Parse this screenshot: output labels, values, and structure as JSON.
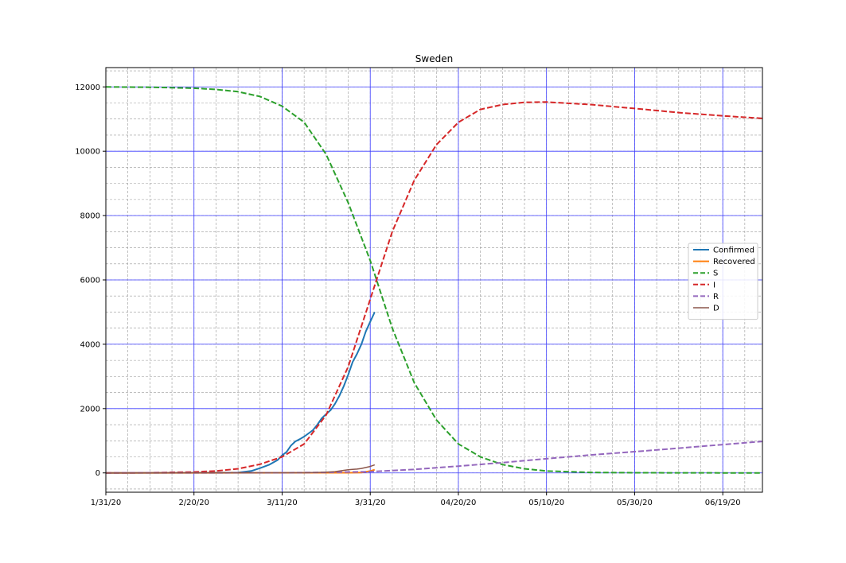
{
  "chart_data": {
    "type": "line",
    "title": "Sweden",
    "xlabel": "",
    "ylabel": "",
    "x_unit": "days since 1/31/20",
    "xlim": [
      0,
      149
    ],
    "ylim": [
      -600,
      12600
    ],
    "x_ticks": [
      {
        "x": 0,
        "label": "1/31/20"
      },
      {
        "x": 20,
        "label": "2/20/20"
      },
      {
        "x": 40,
        "label": "3/11/20"
      },
      {
        "x": 60,
        "label": "3/31/20"
      },
      {
        "x": 80,
        "label": "04/20/20"
      },
      {
        "x": 100,
        "label": "05/10/20"
      },
      {
        "x": 120,
        "label": "05/30/20"
      },
      {
        "x": 140,
        "label": "06/19/20"
      }
    ],
    "y_ticks": [
      0,
      2000,
      4000,
      6000,
      8000,
      10000,
      12000
    ],
    "grid": {
      "major": true,
      "minor": true
    },
    "legend_position": "center-right",
    "series": [
      {
        "name": "Confirmed",
        "color": "#1f77b4",
        "style": "solid",
        "width": 2,
        "x": [
          0,
          30,
          33,
          35,
          37,
          39,
          40,
          41,
          42,
          43,
          44,
          45,
          46,
          47,
          48,
          49,
          50,
          51,
          52,
          53,
          54,
          55,
          56,
          57,
          58,
          59,
          60,
          61
        ],
        "y": [
          0,
          10,
          60,
          150,
          250,
          400,
          550,
          650,
          850,
          980,
          1050,
          1130,
          1230,
          1330,
          1500,
          1700,
          1830,
          1950,
          2150,
          2400,
          2700,
          3050,
          3450,
          3700,
          4000,
          4400,
          4700,
          5000
        ]
      },
      {
        "name": "Recovered",
        "color": "#ff7f0e",
        "style": "solid",
        "width": 2,
        "x": [
          0,
          55,
          58,
          60,
          61
        ],
        "y": [
          0,
          5,
          10,
          60,
          100
        ]
      },
      {
        "name": "S",
        "color": "#2ca02c",
        "style": "dashed",
        "width": 2,
        "x": [
          0,
          10,
          20,
          25,
          30,
          35,
          40,
          45,
          50,
          55,
          60,
          65,
          70,
          75,
          80,
          85,
          90,
          95,
          100,
          110,
          120,
          130,
          140,
          149
        ],
        "y": [
          12000,
          11990,
          11960,
          11920,
          11850,
          11700,
          11400,
          10900,
          9900,
          8400,
          6600,
          4500,
          2800,
          1650,
          900,
          500,
          260,
          130,
          60,
          15,
          5,
          2,
          1,
          0
        ]
      },
      {
        "name": "I",
        "color": "#d62728",
        "style": "dashed",
        "width": 2,
        "x": [
          0,
          10,
          20,
          25,
          30,
          35,
          40,
          45,
          50,
          55,
          60,
          65,
          70,
          75,
          80,
          85,
          90,
          95,
          100,
          110,
          120,
          130,
          140,
          149
        ],
        "y": [
          0,
          5,
          30,
          60,
          130,
          270,
          500,
          900,
          1800,
          3300,
          5400,
          7500,
          9100,
          10200,
          10900,
          11300,
          11450,
          11520,
          11530,
          11450,
          11330,
          11200,
          11100,
          11020
        ]
      },
      {
        "name": "R",
        "color": "#9467bd",
        "style": "dashed",
        "width": 2,
        "x": [
          0,
          40,
          50,
          60,
          70,
          80,
          90,
          100,
          110,
          120,
          130,
          140,
          149
        ],
        "y": [
          0,
          5,
          15,
          40,
          110,
          210,
          320,
          440,
          560,
          660,
          770,
          880,
          980
        ]
      },
      {
        "name": "D",
        "color": "#8c564b",
        "style": "solid",
        "width": 1.5,
        "x": [
          0,
          45,
          48,
          50,
          52,
          54,
          55,
          56,
          57,
          58,
          59,
          60,
          61
        ],
        "y": [
          0,
          5,
          15,
          25,
          40,
          80,
          100,
          110,
          120,
          140,
          170,
          200,
          250
        ]
      }
    ]
  }
}
